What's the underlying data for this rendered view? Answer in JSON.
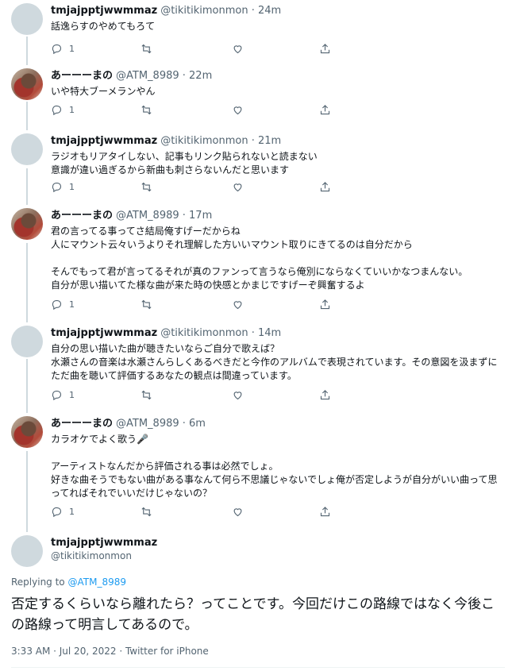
{
  "tweets": [
    {
      "name": "tmjajpptjwwmmaz",
      "handle": "@tikitikimonmon · 24m",
      "text": "話逸らすのやめてもろて",
      "replies": "1"
    },
    {
      "name": "あーーーまの",
      "handle": "@ATM_8989 · 22m",
      "text": "いや特大ブーメランやん",
      "replies": "1"
    },
    {
      "name": "tmjajpptjwwmmaz",
      "handle": "@tikitikimonmon · 21m",
      "text": "ラジオもリアタイしない、記事もリンク貼られないと読まない\n意識が違い過ぎるから新曲も刺さらないんだと思います",
      "replies": "1"
    },
    {
      "name": "あーーーまの",
      "handle": "@ATM_8989 · 17m",
      "text": "君の言ってる事ってさ結局俺すげーだからね\n人にマウント云々いうよりそれ理解した方いいマウント取りにきてるのは自分だから\n\nそんでもって君が言ってるそれが真のファンって言うなら俺別にならなくていいかなつまんない。\n自分が思い描いてた様な曲が来た時の快感とかまじですげーぞ興奮するよ",
      "replies": "1"
    },
    {
      "name": "tmjajpptjwwmmaz",
      "handle": "@tikitikimonmon · 14m",
      "text": "自分の思い描いた曲が聴きたいならご自分で歌えば？\n水瀬さんの音楽は水瀬さんらしくあるべきだと今作のアルバムで表現されています。その意図を汲まずにただ曲を聴いて評価するあなたの観点は間違っています。",
      "replies": "1"
    },
    {
      "name": "あーーーまの",
      "handle": "@ATM_8989 · 6m",
      "text": "カラオケでよく歌う🎤\n\nアーティストなんだから評価される事は必然でしょ。\n好きな曲そうでもない曲がある事なんて何ら不思議じゃないでしょ俺が否定しようが自分がいい曲って思ってればそれでいいだけじゃないの？",
      "replies": "1"
    }
  ],
  "main": {
    "name": "tmjajpptjwwmmaz",
    "handle": "@tikitikimonmon",
    "replying_label": "Replying to",
    "replying_to": "@ATM_8989",
    "text": "否定するくらいなら離れたら？ってことです。今回だけこの路線ではなく今後この路線って明言してあるので。",
    "meta": "3:33 AM · Jul 20, 2022 · Twitter for iPhone"
  },
  "icons": [
    "reply-icon",
    "retweet-icon",
    "like-icon",
    "share-icon"
  ],
  "colors": {
    "link": "#1d9bf0",
    "muted": "#536471",
    "thread_line": "#cfd9de"
  }
}
